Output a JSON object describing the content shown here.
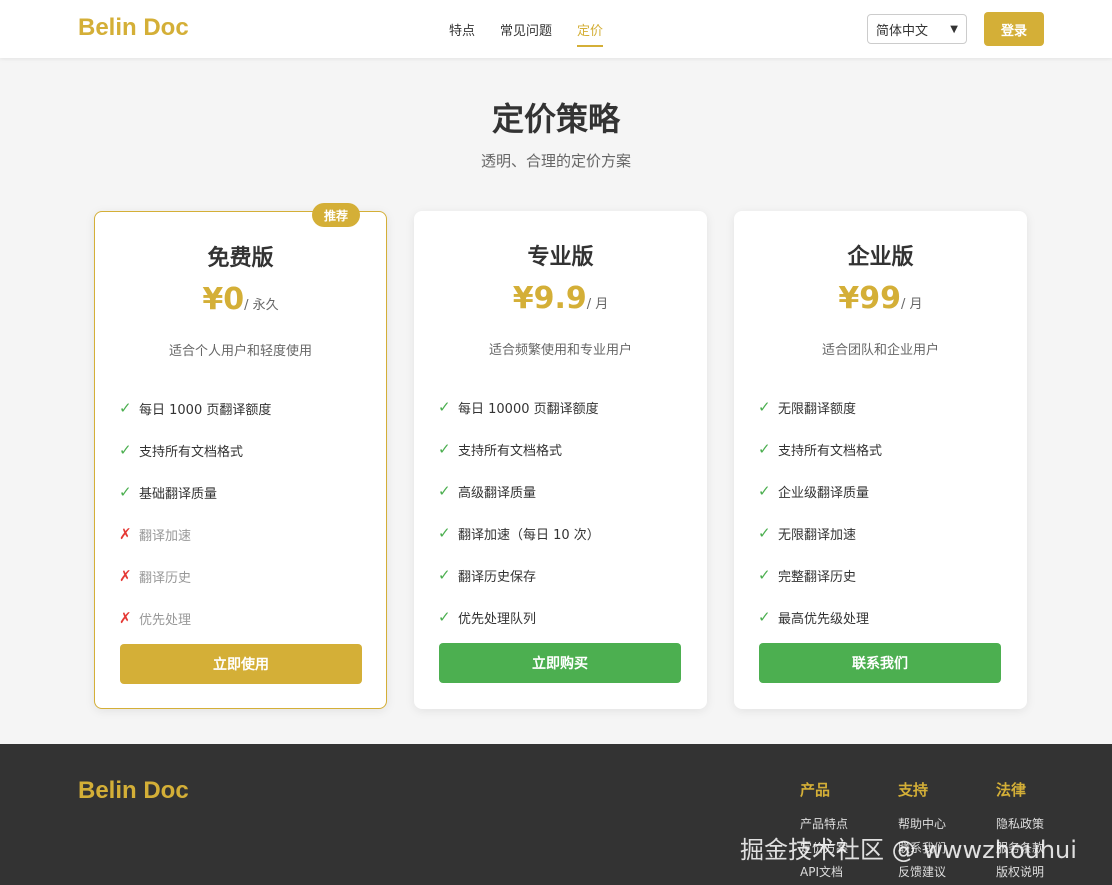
{
  "header": {
    "logo": "Belin Doc",
    "nav": [
      {
        "label": "特点",
        "active": false
      },
      {
        "label": "常见问题",
        "active": false
      },
      {
        "label": "定价",
        "active": true
      }
    ],
    "language": "简体中文",
    "login_label": "登录"
  },
  "hero": {
    "title": "定价策略",
    "subtitle": "透明、合理的定价方案"
  },
  "plans": [
    {
      "name": "免费版",
      "badge": "推荐",
      "price": "¥0",
      "period": "/ 永久",
      "desc": "适合个人用户和轻度使用",
      "features": [
        {
          "text": "每日 1000 页翻译额度",
          "included": true
        },
        {
          "text": "支持所有文档格式",
          "included": true
        },
        {
          "text": "基础翻译质量",
          "included": true
        },
        {
          "text": "翻译加速",
          "included": false
        },
        {
          "text": "翻译历史",
          "included": false
        },
        {
          "text": "优先处理",
          "included": false
        }
      ],
      "cta": "立即使用",
      "cta_color": "#d4af37"
    },
    {
      "name": "专业版",
      "price": "¥9.9",
      "period": "/ 月",
      "desc": "适合频繁使用和专业用户",
      "features": [
        {
          "text": "每日 10000 页翻译额度",
          "included": true
        },
        {
          "text": "支持所有文档格式",
          "included": true
        },
        {
          "text": "高级翻译质量",
          "included": true
        },
        {
          "text": "翻译加速（每日 10 次）",
          "included": true
        },
        {
          "text": "翻译历史保存",
          "included": true
        },
        {
          "text": "优先处理队列",
          "included": true
        }
      ],
      "cta": "立即购买",
      "cta_color": "#4caf50"
    },
    {
      "name": "企业版",
      "price": "¥99",
      "period": "/ 月",
      "desc": "适合团队和企业用户",
      "features": [
        {
          "text": "无限翻译额度",
          "included": true
        },
        {
          "text": "支持所有文档格式",
          "included": true
        },
        {
          "text": "企业级翻译质量",
          "included": true
        },
        {
          "text": "无限翻译加速",
          "included": true
        },
        {
          "text": "完整翻译历史",
          "included": true
        },
        {
          "text": "最高优先级处理",
          "included": true
        }
      ],
      "cta": "联系我们",
      "cta_color": "#4caf50"
    }
  ],
  "marks": {
    "yes": "✓",
    "no": "✗"
  },
  "footer": {
    "logo": "Belin Doc",
    "columns": [
      {
        "title": "产品",
        "links": [
          "产品特点",
          "定价方案",
          "API文档"
        ]
      },
      {
        "title": "支持",
        "links": [
          "帮助中心",
          "联系我们",
          "反馈建议"
        ]
      },
      {
        "title": "法律",
        "links": [
          "隐私政策",
          "服务条款",
          "版权说明"
        ]
      }
    ]
  },
  "watermark": "掘金技术社区 @ wwwzhouhui",
  "colors": {
    "accent": "#d4af37",
    "success": "#4caf50",
    "danger": "#e53935",
    "footer_bg": "#333333"
  }
}
